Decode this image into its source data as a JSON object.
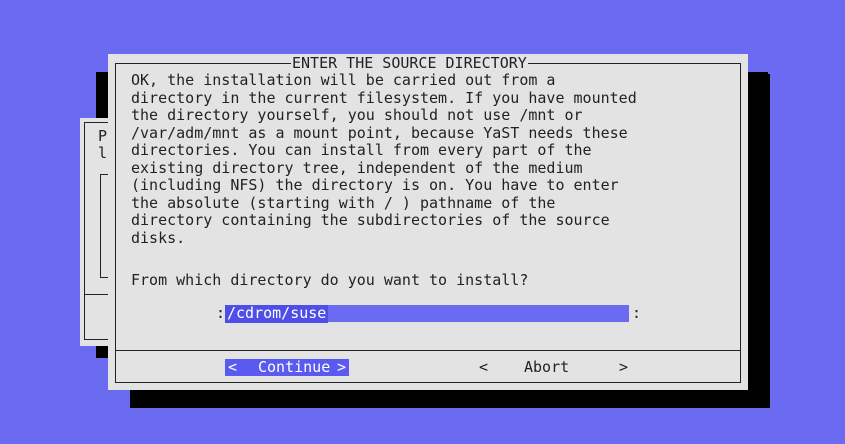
{
  "background_dialog": {
    "line1_char": "P",
    "line2_char": "l"
  },
  "dialog": {
    "title": "ENTER THE SOURCE DIRECTORY",
    "message_lines": [
      "OK, the installation will be carried out from a",
      "directory in the current filesystem. If you have mounted",
      "the directory yourself, you should not use /mnt or",
      "/var/adm/mnt as a mount point, because YaST needs these",
      "directories. You can install from every part of the",
      "existing directory tree, independent of the medium",
      "(including NFS) the directory is on. You have to enter",
      "the absolute (starting with / ) pathname of the",
      "directory containing the subdirectories of the source",
      "disks."
    ],
    "prompt": "From which directory do you want to install?",
    "input": {
      "prefix": ":",
      "value": "/cdrom/suse",
      "suffix": ":"
    },
    "buttons": {
      "continue": {
        "left": "<",
        "label": "Continue",
        "right": ">"
      },
      "abort": {
        "left": "<",
        "label": "Abort",
        "right": ">"
      }
    }
  },
  "colors": {
    "desktop": "#6b6bf2",
    "panel": "#e3e3e3",
    "highlight": "#4f4fe8",
    "shadow": "#000000"
  }
}
